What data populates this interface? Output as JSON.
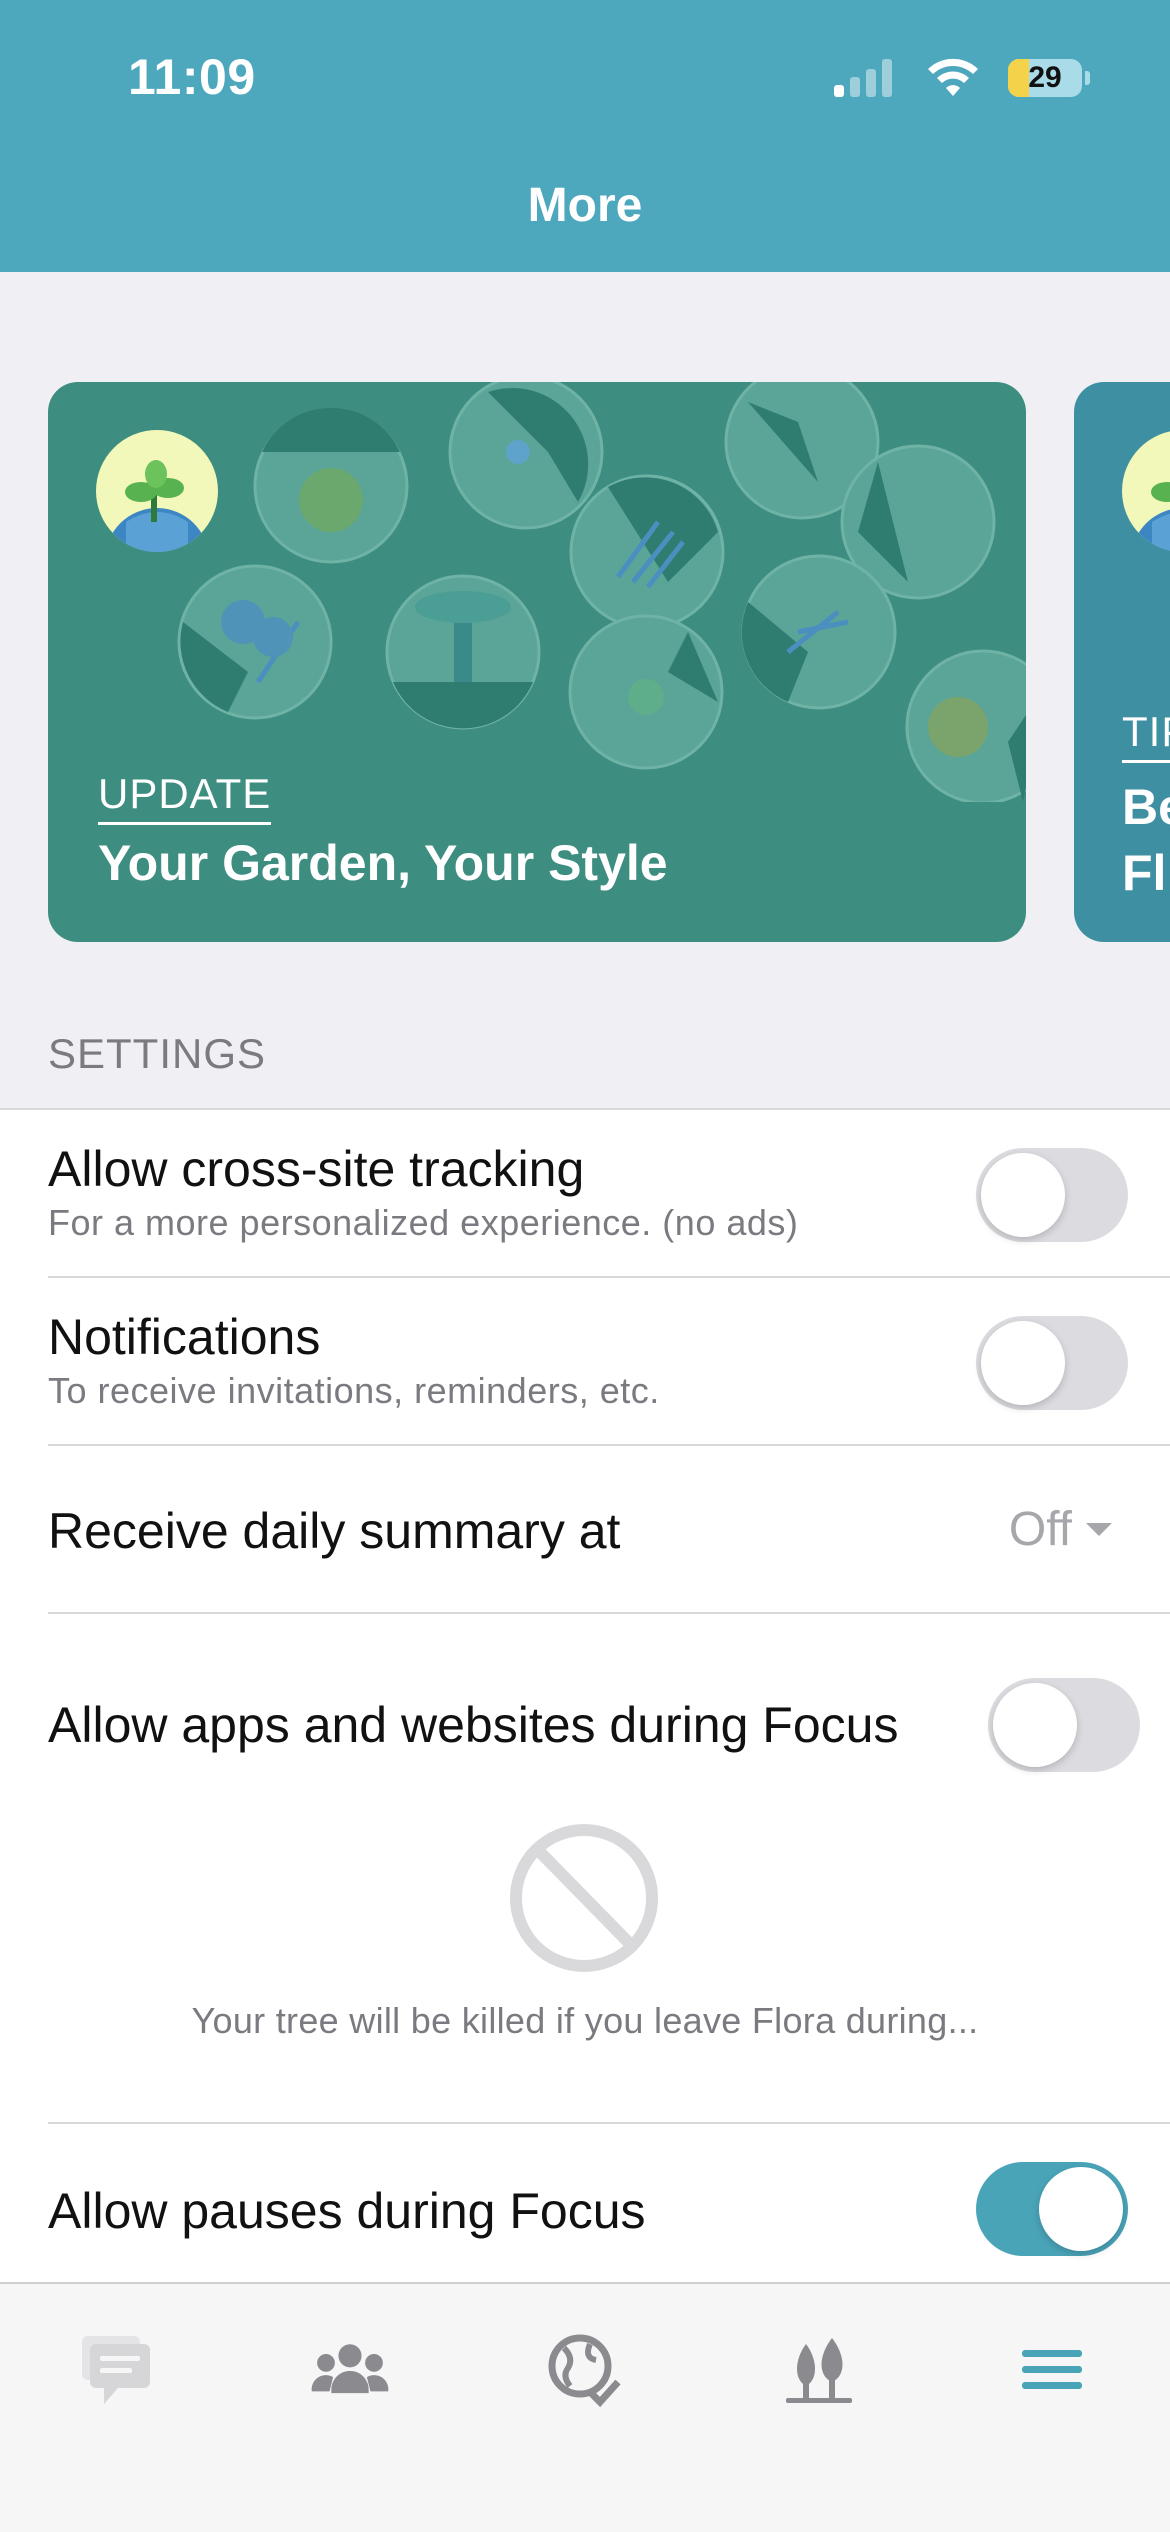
{
  "status_bar": {
    "time": "11:09",
    "battery_level": "29",
    "battery_fill_fraction": 0.29,
    "signal_bars_on": 1,
    "signal_bars_total": 4
  },
  "nav": {
    "title": "More"
  },
  "cards": [
    {
      "tag": "UPDATE",
      "title": "Your Garden, Your Style",
      "art": "plant-circles-illustration"
    },
    {
      "tag": "TIP",
      "title": "Be\nFl",
      "art": "plant-avatar"
    }
  ],
  "settings": {
    "section_title": "SETTINGS",
    "tracking": {
      "label": "Allow cross-site tracking",
      "sub": "For a more personalized experience. (no ads)",
      "on": false
    },
    "notifications": {
      "label": "Notifications",
      "sub": "To receive invitations, reminders, etc.",
      "on": false
    },
    "daily_summary": {
      "label": "Receive daily summary at",
      "value": "Off"
    },
    "allow_apps": {
      "label": "Allow apps and websites during Focus",
      "on": false,
      "warning": "Your tree will be killed if you leave Flora during..."
    },
    "allow_pauses": {
      "label": "Allow pauses during Focus",
      "on": true
    }
  },
  "tabbar": {
    "items": [
      {
        "icon": "chat-icon",
        "active": false
      },
      {
        "icon": "friends-icon",
        "active": false
      },
      {
        "icon": "globe-check-icon",
        "active": false
      },
      {
        "icon": "trees-icon",
        "active": false
      },
      {
        "icon": "menu-icon",
        "active": true
      }
    ]
  },
  "colors": {
    "accent": "#4da8be",
    "card_green": "#3d8e80",
    "card_blue": "#3f8fa2",
    "toggle_on": "#4aa4b8"
  }
}
